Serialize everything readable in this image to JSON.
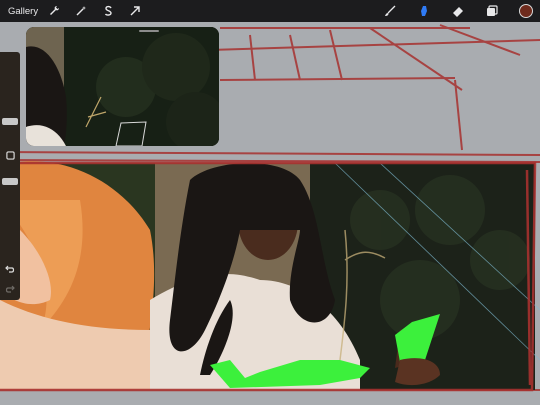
{
  "topbar": {
    "gallery_label": "Gallery"
  },
  "tools": {
    "actions": "wrench-icon",
    "adjustments": "magic-wand-icon",
    "selection": "selection-s-icon",
    "transform": "transform-arrow-icon",
    "brush": "brush-icon",
    "smudge": "smudge-icon",
    "eraser": "eraser-icon",
    "layers": "layers-icon"
  },
  "colors": {
    "active_color": "#6e2a1c",
    "smudge_active": "#2f7bf6",
    "sketch_line": "#a7312f"
  }
}
